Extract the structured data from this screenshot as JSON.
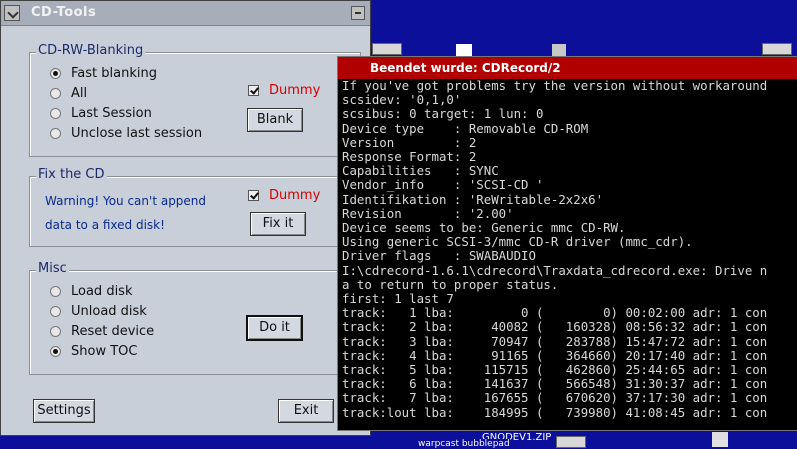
{
  "window": {
    "title": "CD-Tools"
  },
  "blanking": {
    "legend": "CD-RW-Blanking",
    "options": [
      "Fast blanking",
      "All",
      "Last Session",
      "Unclose last session"
    ],
    "selected": 0,
    "dummy_label": "Dummy",
    "blank_button": "Blank"
  },
  "fix": {
    "legend": "Fix the CD",
    "warning_line1": "Warning! You can't append",
    "warning_line2": "data to a fixed disk!",
    "dummy_label": "Dummy",
    "fix_button": "Fix it"
  },
  "misc": {
    "legend": "Misc",
    "options": [
      "Load disk",
      "Unload disk",
      "Reset device",
      "Show TOC"
    ],
    "selected": 3,
    "do_button": "Do it"
  },
  "bottom": {
    "settings_button": "Settings",
    "exit_button": "Exit"
  },
  "console": {
    "title": "Beendet wurde: CDRecord/2",
    "lines": [
      "If you've got problems try the version without workaround",
      "scsidev: '0,1,0'",
      "scsibus: 0 target: 1 lun: 0",
      "Device type    : Removable CD-ROM",
      "Version        : 2",
      "Response Format: 2",
      "Capabilities   : SYNC",
      "Vendor_info    : 'SCSI-CD '",
      "Identifikation : 'ReWritable-2x2x6'",
      "Revision       : '2.00'",
      "Device seems to be: Generic mmc CD-RW.",
      "Using generic SCSI-3/mmc CD-R driver (mmc_cdr).",
      "Driver flags   : SWABAUDIO",
      "I:\\cdrecord-1.6.1\\cdrecord\\Traxdata_cdrecord.exe: Drive n",
      "a to return to proper status.",
      "first: 1 last 7",
      "track:   1 lba:         0 (        0) 00:02:00 adr: 1 con",
      "track:   2 lba:     40082 (   160328) 08:56:32 adr: 1 con",
      "track:   3 lba:     70947 (   283788) 15:47:72 adr: 1 con",
      "track:   4 lba:     91165 (   364660) 20:17:40 adr: 1 con",
      "track:   5 lba:    115715 (   462860) 25:44:65 adr: 1 con",
      "track:   6 lba:    141637 (   566548) 31:30:37 adr: 1 con",
      "track:   7 lba:    167655 (   670620) 37:17:30 adr: 1 con",
      "track:lout lba:    184995 (   739980) 41:08:45 adr: 1 con"
    ]
  },
  "desktop": {
    "label1": "GNODEV1.ZIP",
    "label2": "warpcast bubblepad"
  },
  "colors": {
    "desktop": "#0b0f9a",
    "window": "#c9cfd9",
    "console_title": "#b00000",
    "dummy": "#d40000"
  }
}
